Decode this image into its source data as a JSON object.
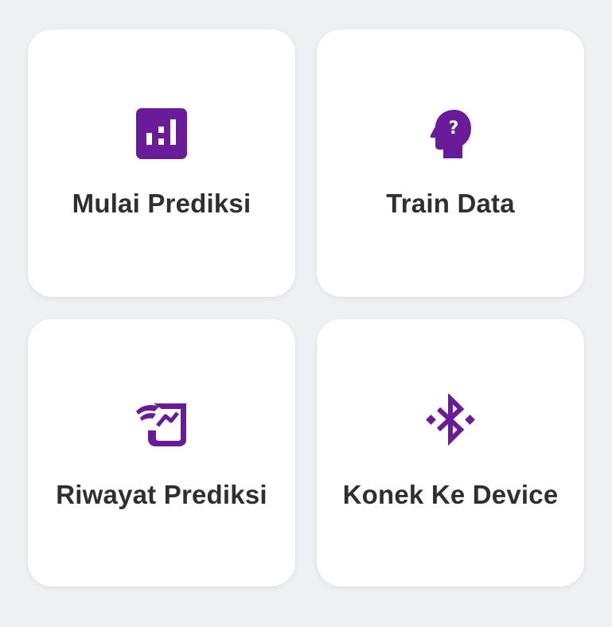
{
  "theme": {
    "accent": "#6a1b9a",
    "background": "#eff0f4",
    "card": "#ffffff",
    "text": "#2f2f2f"
  },
  "menu": {
    "items": [
      {
        "label": "Mulai Prediksi",
        "icon": "bar-chart-icon"
      },
      {
        "label": "Train Data",
        "icon": "head-question-icon"
      },
      {
        "label": "Riwayat Prediksi",
        "icon": "history-scroll-icon"
      },
      {
        "label": "Konek Ke Device",
        "icon": "bluetooth-connect-icon"
      }
    ]
  }
}
